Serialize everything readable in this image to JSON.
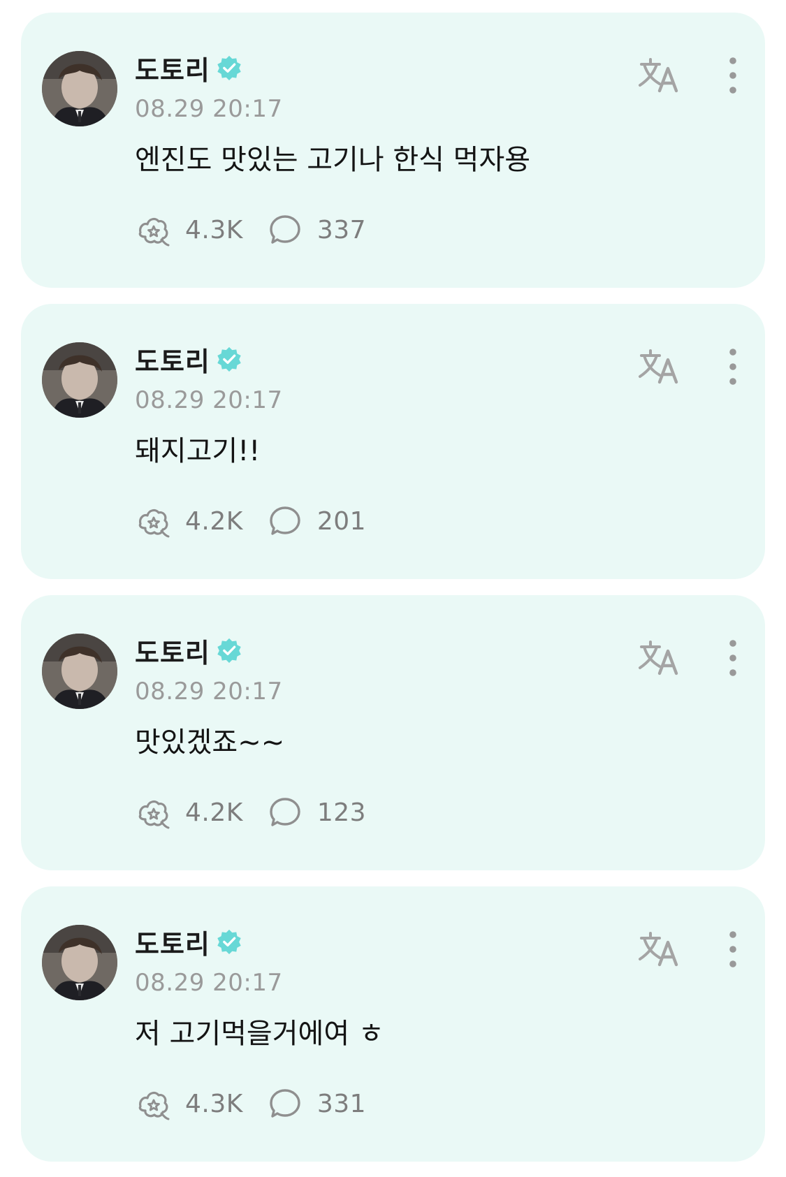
{
  "colors": {
    "card_background": "#eaf9f6",
    "verified_badge": "#67d8d6",
    "muted_text": "#9a9a9a",
    "icon_gray": "#8f8f8f"
  },
  "posts": [
    {
      "author": "도토리",
      "timestamp": "08.29 20:17",
      "text": "엔진도 맛있는 고기나 한식 먹자용",
      "likes": "4.3K",
      "comments": "337"
    },
    {
      "author": "도토리",
      "timestamp": "08.29 20:17",
      "text": "돼지고기!!",
      "likes": "4.2K",
      "comments": "201"
    },
    {
      "author": "도토리",
      "timestamp": "08.29 20:17",
      "text": "맛있겠죠~~",
      "likes": "4.2K",
      "comments": "123"
    },
    {
      "author": "도토리",
      "timestamp": "08.29 20:17",
      "text": "저 고기먹을거에여 ㅎ",
      "likes": "4.3K",
      "comments": "331"
    }
  ],
  "icons": {
    "verified": "verified-badge-icon",
    "like": "like-sparkle-icon",
    "comment": "comment-bubble-icon",
    "translate": "translate-icon",
    "more": "more-vertical-icon"
  }
}
